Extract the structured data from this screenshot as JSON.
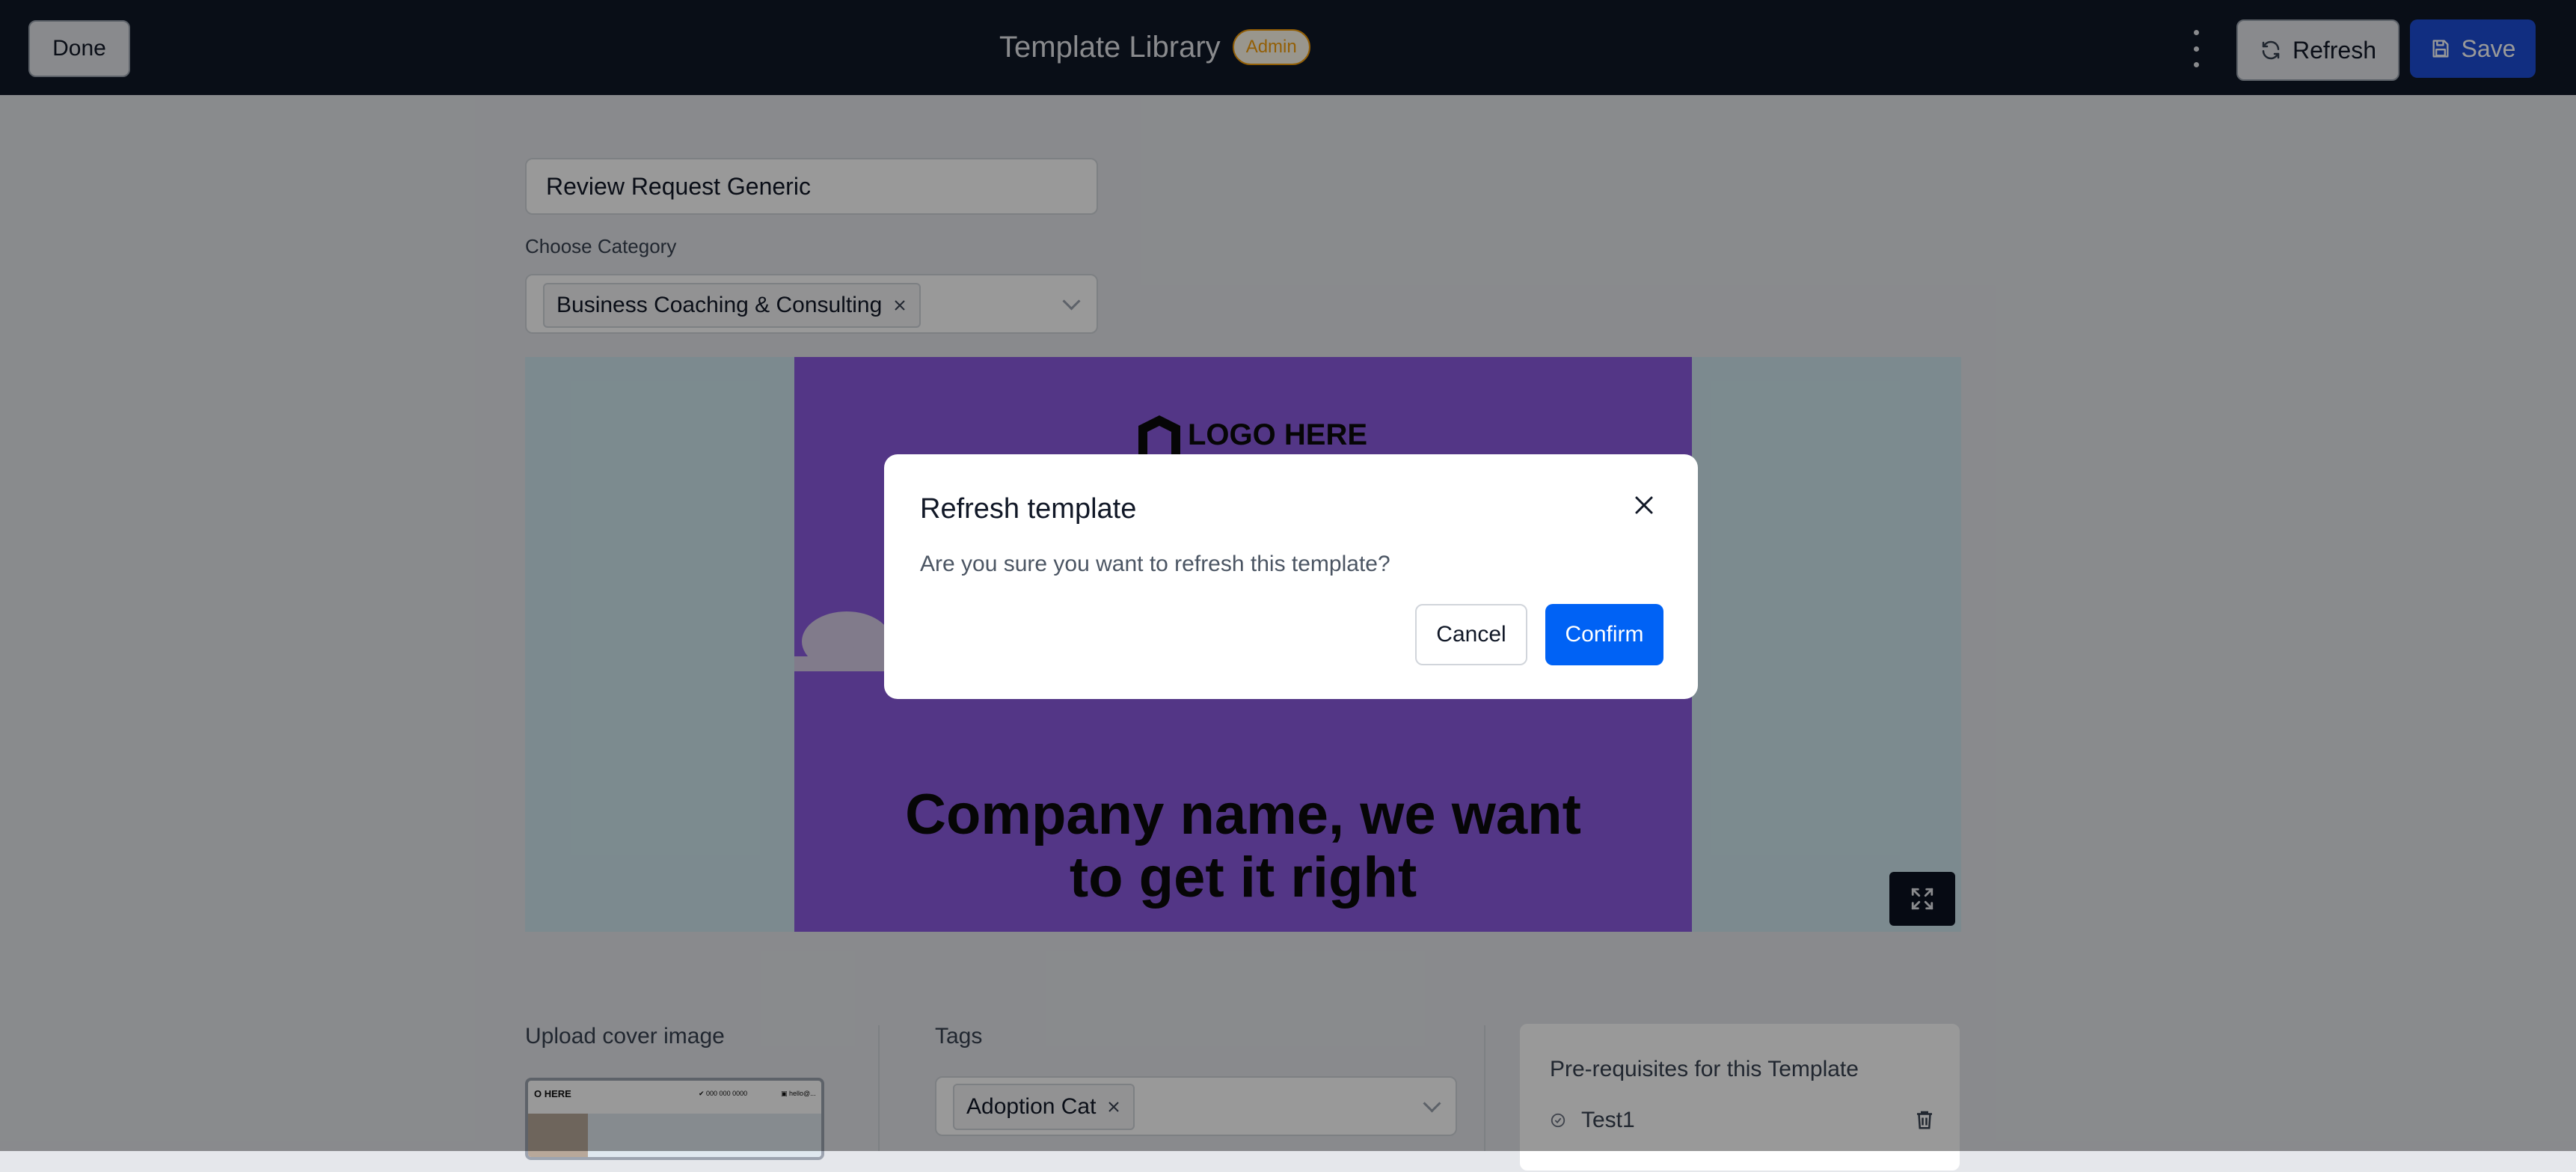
{
  "header": {
    "done_label": "Done",
    "title": "Template Library",
    "badge": "Admin",
    "refresh_label": "Refresh",
    "save_label": "Save",
    "icons": {
      "more": "more-vertical-icon",
      "refresh": "refresh-icon",
      "save": "save-icon"
    }
  },
  "form": {
    "template_name": "Review Request Generic",
    "category_label": "Choose Category",
    "category_selected": "Business Coaching & Consulting"
  },
  "preview": {
    "logo_text": "LOGO HERE",
    "headline_line1": "Company name, we want",
    "headline_line2": "to get it right",
    "poster_color": "#8a5ae0"
  },
  "cover": {
    "label": "Upload cover image",
    "thumb_logo": "O HERE",
    "thumb_text1": "✔ 000 000 0000",
    "thumb_text2": "▣ hello@..."
  },
  "tags": {
    "label": "Tags",
    "selected": "Adoption Cat"
  },
  "prerequisites": {
    "title": "Pre-requisites for this Template",
    "items": [
      "Test1"
    ]
  },
  "modal": {
    "title": "Refresh template",
    "message": "Are you sure you want to refresh this template?",
    "cancel_label": "Cancel",
    "confirm_label": "Confirm",
    "confirm_color": "#0062f5"
  }
}
